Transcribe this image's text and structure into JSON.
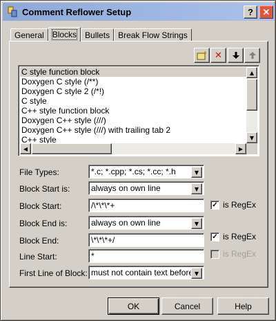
{
  "window": {
    "title": "Comment Reflower Setup",
    "help_glyph": "?",
    "close_glyph": "✕"
  },
  "tabs": [
    {
      "label": "General"
    },
    {
      "label": "Blocks",
      "active": true
    },
    {
      "label": "Bullets"
    },
    {
      "label": "Break Flow Strings"
    }
  ],
  "toolbar": {
    "new_glyph": "▤",
    "delete_glyph": "✕",
    "down_glyph": "🡓",
    "up_glyph": "🡑"
  },
  "block_list": {
    "items": [
      "C style function block",
      "Doxygen C style (/**)",
      "Doxygen C style 2 (/*!)",
      "C style",
      "C++ style function block",
      "Doxygen C++ style (///)",
      "Doxygen C++ style (///) with trailing tab 2",
      "C++ style"
    ],
    "selected_index": 0
  },
  "form": {
    "file_types": {
      "label": "File Types:",
      "value": "*.c; *.cpp; *.cs; *.cc; *.h"
    },
    "block_start_is": {
      "label": "Block Start is:",
      "value": "always on own line"
    },
    "block_start": {
      "label": "Block Start:",
      "value": "/\\*\\*\\*+"
    },
    "block_start_regex": {
      "label": "is RegEx",
      "checked": true
    },
    "block_end_is": {
      "label": "Block End is:",
      "value": "always on own line"
    },
    "block_end": {
      "label": "Block End:",
      "value": "\\*\\*\\*+/"
    },
    "block_end_regex": {
      "label": "is RegEx",
      "checked": true
    },
    "line_start": {
      "label": "Line Start:",
      "value": "*"
    },
    "line_start_regex": {
      "label": "is RegEx",
      "checked": false,
      "disabled": true
    },
    "first_line": {
      "label": "First Line of Block:",
      "value": "must not contain text before start"
    }
  },
  "buttons": {
    "ok": "OK",
    "cancel": "Cancel",
    "help": "Help"
  },
  "colors": {
    "face": "#d4d0c8",
    "title_gradient_start": "#8fa8d8",
    "title_gradient_end": "#aac2ea",
    "close": "#e5533a"
  }
}
